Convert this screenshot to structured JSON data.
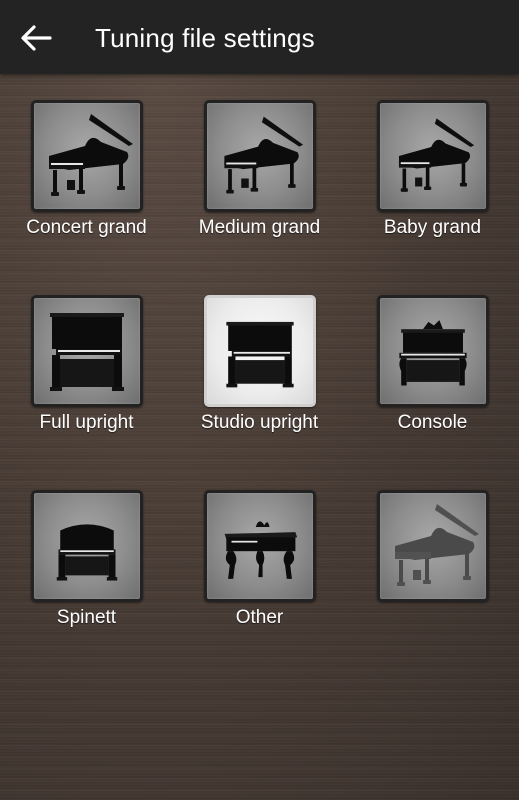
{
  "appbar": {
    "title": "Tuning file settings",
    "back_icon": "arrow-left-icon"
  },
  "tiles": [
    {
      "label": "Concert grand",
      "icon": "grand-piano-icon",
      "selected": false
    },
    {
      "label": "Medium grand",
      "icon": "grand-piano-icon",
      "selected": false
    },
    {
      "label": "Baby grand",
      "icon": "grand-piano-icon",
      "selected": false
    },
    {
      "label": "Full upright",
      "icon": "upright-piano-icon",
      "selected": false
    },
    {
      "label": "Studio upright",
      "icon": "upright-piano-icon",
      "selected": true
    },
    {
      "label": "Console",
      "icon": "console-piano-icon",
      "selected": false
    },
    {
      "label": "Spinett",
      "icon": "spinet-piano-icon",
      "selected": false
    },
    {
      "label": "Other",
      "icon": "antique-piano-icon",
      "selected": false
    },
    {
      "label": "",
      "icon": "grand-piano-silhouette-icon",
      "selected": false
    }
  ],
  "colors": {
    "appbar_bg": "#232323",
    "tile_border": "#222222",
    "selected_tile_bg": "#ececec",
    "background": "#463a33"
  }
}
